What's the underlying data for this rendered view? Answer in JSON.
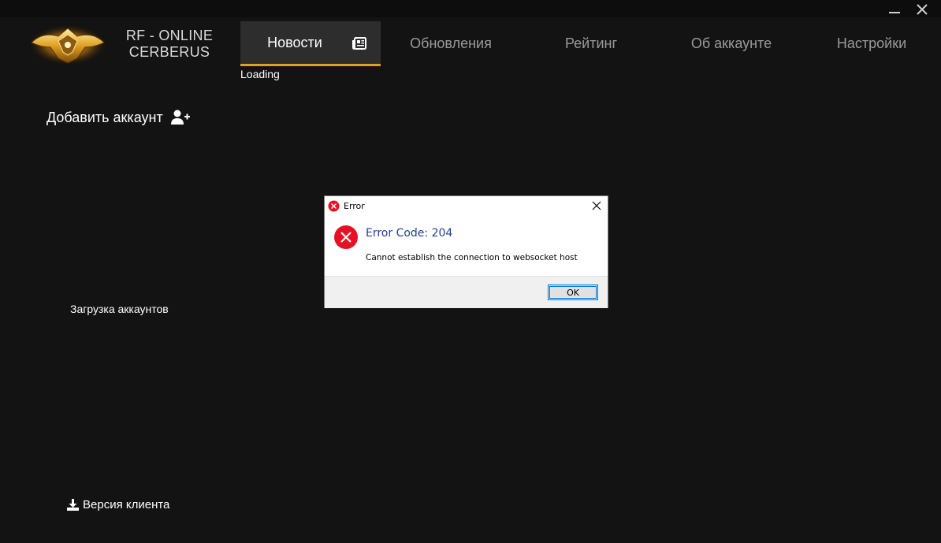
{
  "window": {
    "minimize_icon": "minimize-icon",
    "close_icon": "close-icon"
  },
  "brand": {
    "line1": "RF - ONLINE",
    "line2": "CERBERUS",
    "logo_icon": "cerberus-logo"
  },
  "tabs": [
    {
      "label": "Новости",
      "active": true,
      "icon": "newspaper-icon"
    },
    {
      "label": "Обновления",
      "active": false
    },
    {
      "label": "Рейтинг",
      "active": false
    },
    {
      "label": "Об аккаунте",
      "active": false
    },
    {
      "label": "Настройки",
      "active": false
    }
  ],
  "news": {
    "status": "Loading"
  },
  "sidebar": {
    "add_account_label": "Добавить аккаунт",
    "add_account_icon": "user-plus-icon",
    "accounts_status": "Загрузка аккаунтов",
    "client_version_label": "Версия клиента",
    "client_version_icon": "download-icon"
  },
  "dialog": {
    "title": "Error",
    "heading": "Error Code: 204",
    "message": "Cannot establish the connection to websocket host",
    "ok_label": "OK"
  },
  "colors": {
    "background": "#131313",
    "accent": "#e0a023",
    "active_tab": "#2d2d2d",
    "error_red": "#e81123",
    "dialog_heading": "#1f3f99"
  }
}
